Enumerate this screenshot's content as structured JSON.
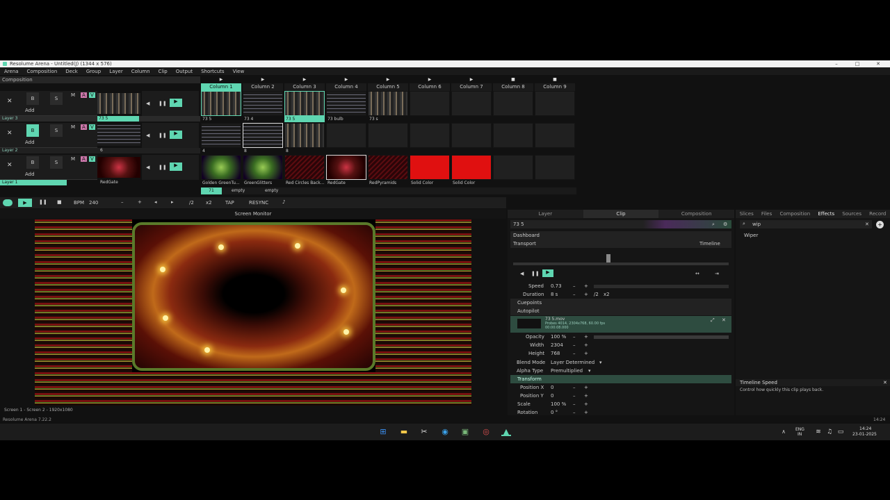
{
  "window": {
    "title": "Resolume Arena - Untitled(J) (1344 x 576)"
  },
  "menu": [
    "Arena",
    "Composition",
    "Deck",
    "Group",
    "Layer",
    "Column",
    "Clip",
    "Output",
    "Shortcuts",
    "View"
  ],
  "composition": {
    "label": "Composition"
  },
  "columns": [
    "Column 1",
    "Column 2",
    "Column 3",
    "Column 4",
    "Column 5",
    "Column 6",
    "Column 7",
    "Column 8",
    "Column 9"
  ],
  "layers": [
    {
      "name": "Layer 3",
      "clip_names": [
        "73 5",
        "73 4",
        "73 5",
        "73 bulb",
        "73 s",
        "",
        "",
        "",
        ""
      ],
      "ctl_clip": "73 5"
    },
    {
      "name": "Layer 2",
      "clip_names": [
        "4",
        "8",
        "8",
        "",
        "",
        "",
        "",
        "",
        ""
      ],
      "ctl_clip": "6"
    },
    {
      "name": "Layer 1",
      "clip_names": [
        "Golden GreenTu...",
        "GreenGlitters",
        "Red Circles Back...",
        "RedGate",
        "RedPyramids",
        "Solid Color",
        "Solid Color",
        "",
        ""
      ],
      "ctl_clip": "RedGate"
    }
  ],
  "layer_buttons": {
    "b": "B",
    "s": "S",
    "x": "✕",
    "add": "Add",
    "m": "M",
    "a": "A",
    "v": "V"
  },
  "deck": {
    "items": [
      "71",
      "empty",
      "empty"
    ]
  },
  "transport": {
    "bpm_label": "BPM",
    "bpm": "240",
    "tap": "TAP",
    "resync": "RESYNC",
    "minus": "–",
    "plus": "+",
    "div": "/2",
    "mul": "x2"
  },
  "monitor": {
    "title": "Screen Monitor",
    "footer": "Screen 1 - Screen 2 - 1920x1080"
  },
  "panel": {
    "tabs": [
      "Layer",
      "Clip",
      "Composition"
    ],
    "clip_name": "73 5",
    "dashboard": "Dashboard",
    "transport": "Transport",
    "timeline": "Timeline",
    "speed_label": "Speed",
    "speed_value": "0.73",
    "duration_label": "Duration",
    "duration_value": "8 s",
    "div": "/2",
    "mul": "x2",
    "cuepoints": "Cuepoints",
    "autopilot": "Autopilot",
    "file_name": "73 5.mov",
    "file_info": "Probes 4014, 2304x768, 60.00 fps",
    "file_time": "00:00:08.000",
    "opacity_label": "Opacity",
    "opacity_value": "100 %",
    "width_label": "Width",
    "width_value": "2304",
    "height_label": "Height",
    "height_value": "768",
    "blend_label": "Blend Mode",
    "blend_value": "Layer Determined",
    "alpha_label": "Alpha Type",
    "alpha_value": "Premultiplied",
    "transform": "Transform",
    "posx_label": "Position X",
    "posx_value": "0",
    "posy_label": "Position Y",
    "posy_value": "0",
    "scale_label": "Scale",
    "scale_value": "100 %",
    "rotation_label": "Rotation",
    "rotation_value": "0 °"
  },
  "right": {
    "tabs": [
      "Slices",
      "Files",
      "Composition",
      "Effects",
      "Sources",
      "Record"
    ],
    "search_value": "wip",
    "result": "Wiper",
    "help_title": "Timeline Speed",
    "help_text": "Control how quickly this clip plays back."
  },
  "statusbar": {
    "left": "Resolume Arena 7.22.2",
    "right": "14:24"
  },
  "taskbar": {
    "lang": "ENG",
    "region": "IN",
    "time": "14:24",
    "date": "23-01-2025"
  },
  "colors": {
    "accent": "#5fd6b1",
    "solid": "#e01010"
  }
}
